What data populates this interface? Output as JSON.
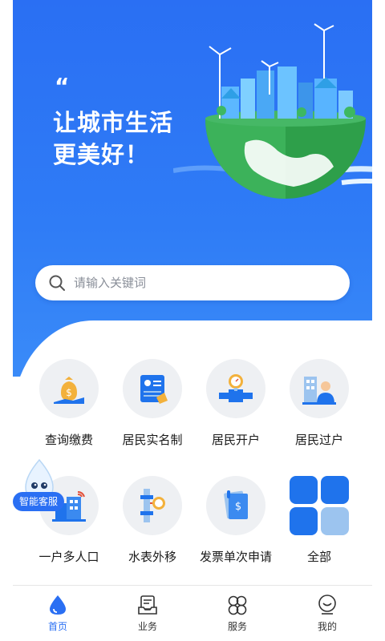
{
  "hero": {
    "quote_mark": "“",
    "line1": "让城市生活",
    "line2": "更美好！"
  },
  "search": {
    "placeholder": "请输入关键词",
    "value": ""
  },
  "services": [
    {
      "label": "查询缴费",
      "icon": "money-bag-icon"
    },
    {
      "label": "居民实名制",
      "icon": "id-document-icon"
    },
    {
      "label": "居民开户",
      "icon": "water-pipe-icon"
    },
    {
      "label": "居民过户",
      "icon": "building-person-icon"
    },
    {
      "label": "一户多人口",
      "icon": "building-wifi-icon"
    },
    {
      "label": "水表外移",
      "icon": "water-meter-icon"
    },
    {
      "label": "发票单次申请",
      "icon": "invoice-icon"
    },
    {
      "label": "全部",
      "icon": "grid-all-icon"
    }
  ],
  "customer_service": {
    "label": "智能客服"
  },
  "tabbar": {
    "items": [
      {
        "label": "首页",
        "icon": "water-drop-icon",
        "active": true
      },
      {
        "label": "业务",
        "icon": "document-tray-icon",
        "active": false
      },
      {
        "label": "服务",
        "icon": "clover-grid-icon",
        "active": false
      },
      {
        "label": "我的",
        "icon": "user-face-icon",
        "active": false
      }
    ]
  },
  "colors": {
    "primary": "#2a6ff3",
    "grid_blue": "#1f73ec",
    "grid_light": "#9cc4ef"
  }
}
